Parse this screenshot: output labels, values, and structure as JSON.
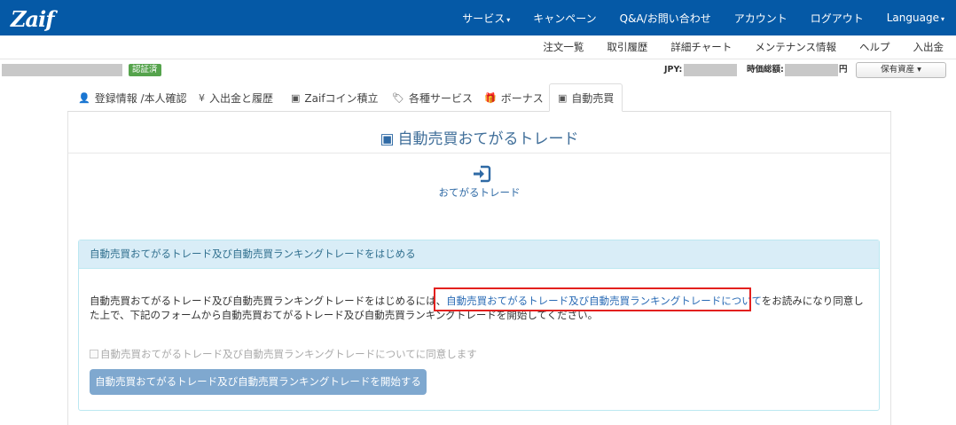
{
  "app": {
    "logo": "Zaif"
  },
  "topnav": {
    "items": [
      {
        "label": "サービス",
        "caret": "▾"
      },
      {
        "label": "キャンペーン"
      },
      {
        "label": "Q&A/お問い合わせ"
      },
      {
        "label": "アカウント"
      },
      {
        "label": "ログアウト"
      },
      {
        "label": "Language",
        "caret": "▾"
      }
    ]
  },
  "subnav": {
    "items": [
      "注文一覧",
      "取引履歴",
      "詳細チャート",
      "メンテナンス情報",
      "ヘルプ",
      "入出金"
    ]
  },
  "user": {
    "verified_badge": "認証済",
    "jpy_label": "JPY:",
    "valuation_label": "時価総額:",
    "yen_unit": "円",
    "holdings_button": "保有資産",
    "holdings_caret": "▾"
  },
  "tabs": [
    {
      "icon": "user-icon",
      "glyph": "👤",
      "label": "登録情報 /本人確認"
    },
    {
      "icon": "yen-icon",
      "glyph": "¥",
      "label": "入出金と履歴"
    },
    {
      "icon": "inbox-icon",
      "glyph": "▣",
      "label": "Zaifコイン積立"
    },
    {
      "icon": "tag-icon",
      "glyph": "🏷",
      "label": "各種サービス"
    },
    {
      "icon": "gift-icon",
      "glyph": "🎁",
      "label": "ボーナス"
    },
    {
      "icon": "inbox-icon",
      "glyph": "▣",
      "label": "自動売買",
      "active": true
    }
  ],
  "panel": {
    "title": "自動売買おてがるトレード",
    "title_icon": "inbox-icon",
    "sub_icon": "sign-in-icon",
    "sub_label": "おてがるトレード"
  },
  "info": {
    "heading": "自動売買おてがるトレード及び自動売買ランキングトレードをはじめる",
    "para_before": "自動売買おてがるトレード及び自動売買ランキングトレードをはじめるには、",
    "para_link": "自動売買おてがるトレード及び自動売買ランキングトレードについて",
    "para_after": "をお読みになり同意した上で、下記のフォームから自動売買おてがるトレード及び自動売買ランキングトレードを開始してください。",
    "agree_label": "自動売買おてがるトレード及び自動売買ランキングトレードについてに同意します",
    "start_button": "自動売買おてがるトレード及び自動売買ランキングトレードを開始する"
  },
  "colors": {
    "header_bg": "#0559a6",
    "verified_bg": "#55a34c",
    "info_head_bg": "#d9edf7",
    "link": "#2a6bb5",
    "highlight_border": "#e3201e",
    "button_bg": "#7fa8cf"
  }
}
